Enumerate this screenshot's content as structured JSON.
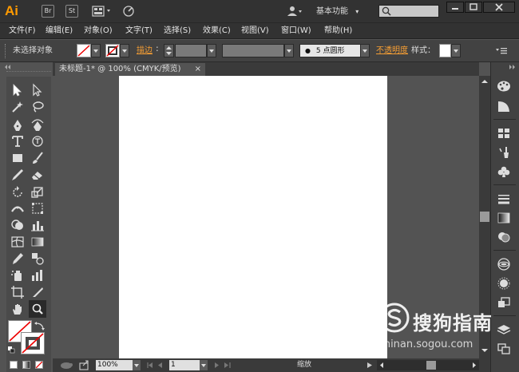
{
  "app": {
    "logo": "Ai",
    "bridge_label": "Br",
    "stock_label": "St",
    "workspace": "基本功能",
    "search_placeholder": ""
  },
  "menu": [
    {
      "label": "文件(F)"
    },
    {
      "label": "编辑(E)"
    },
    {
      "label": "对象(O)"
    },
    {
      "label": "文字(T)"
    },
    {
      "label": "选择(S)"
    },
    {
      "label": "效果(C)"
    },
    {
      "label": "视图(V)"
    },
    {
      "label": "窗口(W)"
    },
    {
      "label": "帮助(H)"
    }
  ],
  "control": {
    "selection_status": "未选择对象",
    "stroke_label": "描边",
    "brush_label": "5 点圆形",
    "opacity_label": "不透明度",
    "style_label": "样式："
  },
  "document": {
    "tab_title": "未标题-1* @ 100% (CMYK/预览)",
    "tab_close": "×"
  },
  "statusbar": {
    "zoom": "100%",
    "page": "1",
    "label": "缩放"
  },
  "watermark": {
    "text": "搜狗指南",
    "url": "zhinan.sogou.com"
  },
  "colors": {
    "accent_orange": "#ff9a00",
    "link_orange": "#f59e34",
    "ui_dark": "#323232",
    "ui_mid": "#535353",
    "artboard": "#ffffff"
  }
}
